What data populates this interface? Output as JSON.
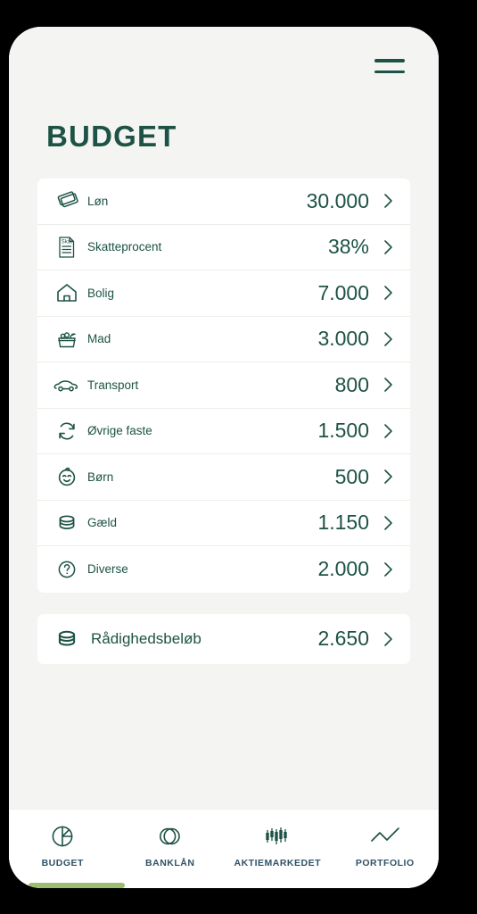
{
  "app": {
    "title": "BUDGET",
    "menu_icon": "hamburger-menu-icon",
    "accent_green": "#1d5245",
    "nav_label_color": "#2f5266",
    "active_indicator_color": "#9cbc6e",
    "screen_background": "#f4f5f3",
    "card_background": "#ffffff"
  },
  "budget_rows": [
    {
      "icon": "banknotes-icon",
      "label": "Løn",
      "value": "30.000",
      "chevron": "chevron-right-icon"
    },
    {
      "icon": "tax-document-icon",
      "label": "Skatteprocent",
      "value": "38%",
      "chevron": "chevron-right-icon"
    },
    {
      "icon": "house-icon",
      "label": "Bolig",
      "value": "7.000",
      "chevron": "chevron-right-icon"
    },
    {
      "icon": "grocery-basket-icon",
      "label": "Mad",
      "value": "3.000",
      "chevron": "chevron-right-icon"
    },
    {
      "icon": "car-icon",
      "label": "Transport",
      "value": "800",
      "chevron": "chevron-right-icon"
    },
    {
      "icon": "recurring-icon",
      "label": "Øvrige faste",
      "value": "1.500",
      "chevron": "chevron-right-icon"
    },
    {
      "icon": "child-face-icon",
      "label": "Børn",
      "value": "500",
      "chevron": "chevron-right-icon"
    },
    {
      "icon": "coins-stack-icon",
      "label": "Gæld",
      "value": "1.150",
      "chevron": "chevron-right-icon"
    },
    {
      "icon": "question-mark-icon",
      "label": "Diverse",
      "value": "2.000",
      "chevron": "chevron-right-icon"
    }
  ],
  "summary_row": {
    "icon": "coins-stack-icon",
    "label": "Rådighedsbeløb",
    "value": "2.650",
    "chevron": "chevron-right-icon"
  },
  "bottom_nav": {
    "active_index": 0,
    "items": [
      {
        "icon": "pie-chart-icon",
        "label": "BUDGET"
      },
      {
        "icon": "two-circles-icon",
        "label": "BANKLÅN"
      },
      {
        "icon": "candlestick-icon",
        "label": "AKTIEMARKEDET"
      },
      {
        "icon": "line-chart-icon",
        "label": "PORTFOLIO"
      }
    ]
  },
  "tax_icon_text": "Skat"
}
